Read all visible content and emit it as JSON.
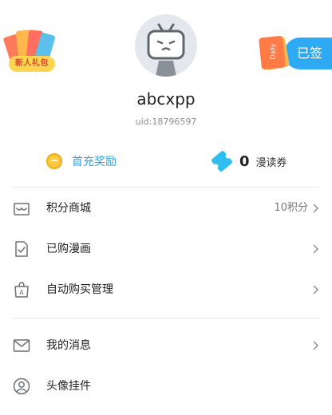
{
  "profile": {
    "username": "abcxpp",
    "uid": "uid:18796597"
  },
  "promo": {
    "new_user_gift": "新人礼包"
  },
  "signin": {
    "daily": "Daily",
    "status": "已签"
  },
  "stats": {
    "recharge": "首充奖励",
    "ticket_count": "0",
    "ticket_label": "漫读券"
  },
  "menu": {
    "items": [
      {
        "label": "积分商城",
        "value": "10积分",
        "icon": "shop-icon"
      },
      {
        "label": "已购漫画",
        "value": "",
        "icon": "purchased-icon"
      },
      {
        "label": "自动购买管理",
        "value": "",
        "icon": "auto-buy-icon"
      },
      {
        "label": "我的消息",
        "value": "",
        "icon": "mail-icon"
      },
      {
        "label": "头像挂件",
        "value": "",
        "icon": "avatar-pendant-icon"
      }
    ]
  },
  "colors": {
    "accent_blue": "#2eaaf4",
    "link_blue": "#2ea3e8",
    "coin_yellow": "#ffc83d",
    "ticket_blue": "#2ebdef"
  }
}
